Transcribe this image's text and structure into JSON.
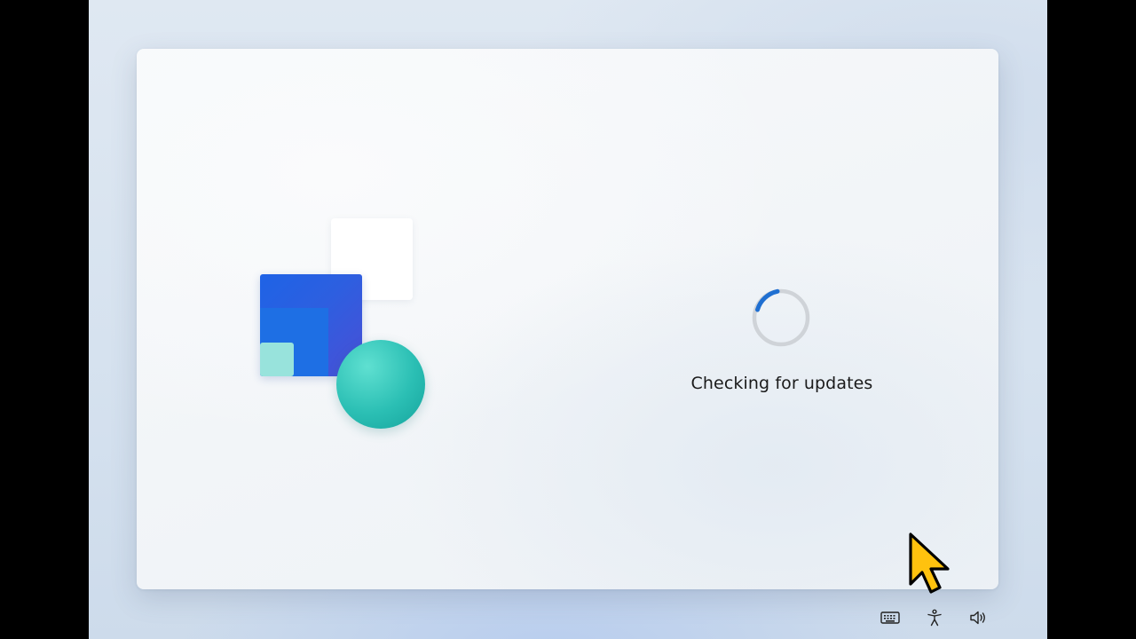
{
  "status": {
    "message": "Checking for updates"
  },
  "spinner": {
    "track_color": "#cfd3d8",
    "arc_color": "#1f6fd1"
  },
  "illustration": {
    "colors": {
      "white_tile": "#ffffff",
      "blue_tile": "#1e63e6",
      "small_tile": "#98e3dc",
      "circle": "#2bbfb4"
    }
  },
  "tray": {
    "icons": [
      "keyboard-icon",
      "accessibility-icon",
      "volume-icon"
    ]
  },
  "cursor": {
    "color": "#ffc20e",
    "outline": "#000000"
  }
}
